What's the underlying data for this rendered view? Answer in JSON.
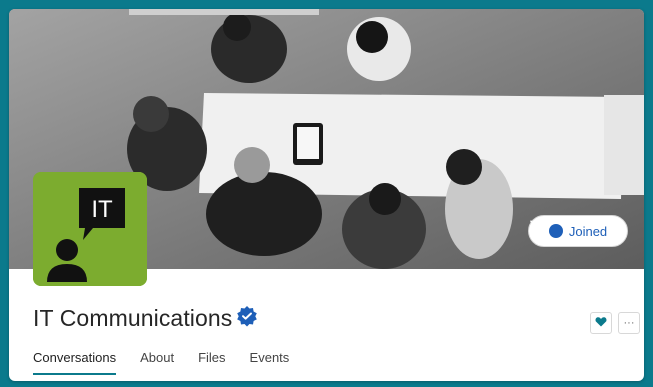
{
  "group": {
    "name": "IT Communications",
    "logo_text": "IT",
    "joined_label": "Joined"
  },
  "tabs": [
    {
      "label": "Conversations",
      "active": true
    },
    {
      "label": "About",
      "active": false
    },
    {
      "label": "Files",
      "active": false
    },
    {
      "label": "Events",
      "active": false
    }
  ],
  "icons": {
    "verified": "verified-badge-icon",
    "heart": "heart-icon",
    "more": "more-options-icon",
    "joined_check": "check-circle-icon"
  },
  "actions": {
    "more_label": "···"
  },
  "colors": {
    "background": "#0b7a8c",
    "logo_bg": "#7cac2f",
    "accent_blue": "#1e5fb8",
    "heart": "#0b7a8c"
  }
}
